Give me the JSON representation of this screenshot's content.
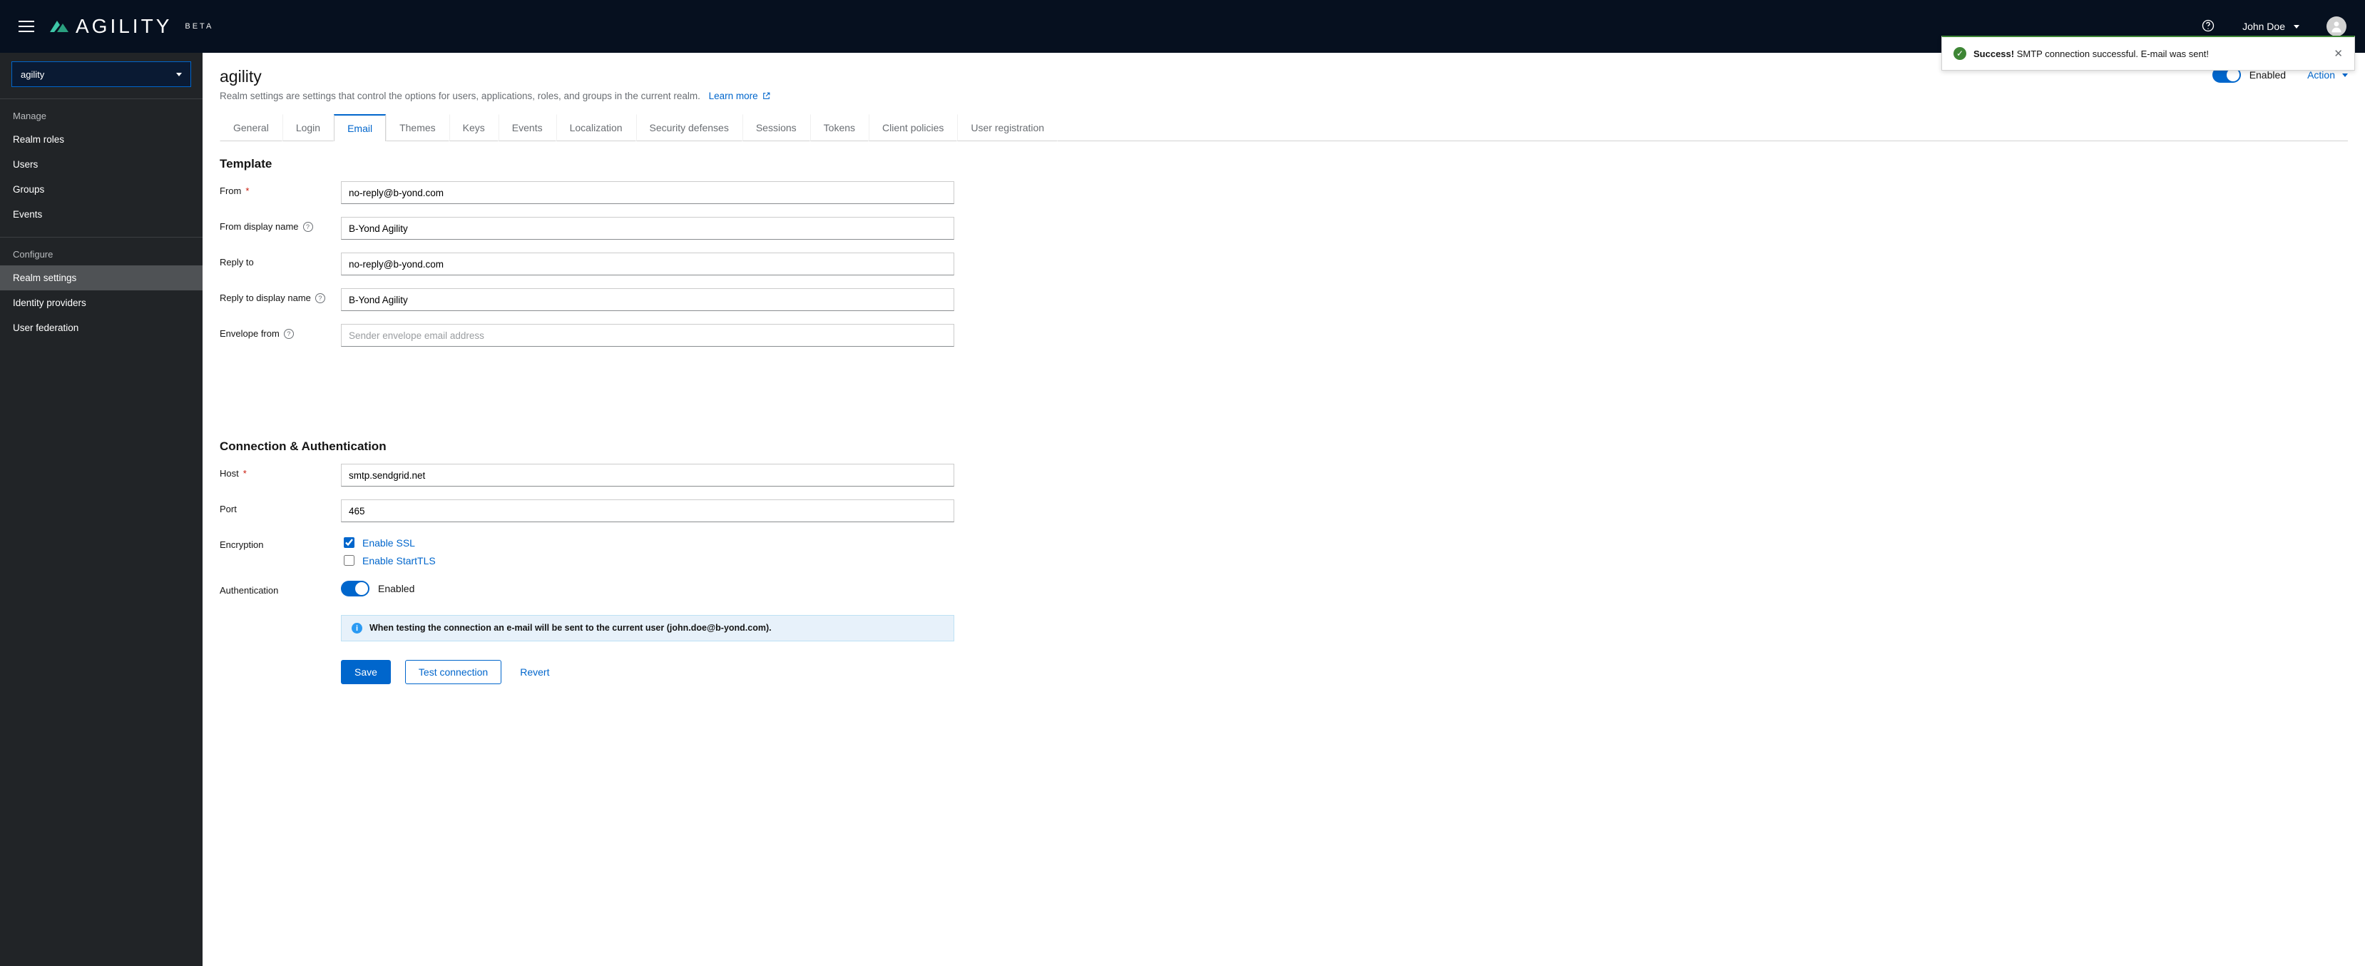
{
  "brand": {
    "name": "AGILITY",
    "beta": "BETA"
  },
  "header": {
    "username": "John Doe"
  },
  "toast": {
    "title": "Success!",
    "message": "SMTP connection successful. E-mail was sent!"
  },
  "sidebar": {
    "realm_selected": "agility",
    "manage_label": "Manage",
    "configure_label": "Configure",
    "items_manage": [
      "Realm roles",
      "Users",
      "Groups",
      "Events"
    ],
    "items_configure": [
      "Realm settings",
      "Identity providers",
      "User federation"
    ]
  },
  "page": {
    "title": "agility",
    "description": "Realm settings are settings that control the options for users, applications, roles, and groups in the current realm.",
    "learn_more": "Learn more",
    "enabled_label": "Enabled",
    "action_label": "Action"
  },
  "tabs": [
    "General",
    "Login",
    "Email",
    "Themes",
    "Keys",
    "Events",
    "Localization",
    "Security defenses",
    "Sessions",
    "Tokens",
    "Client policies",
    "User registration"
  ],
  "template_section": {
    "title": "Template",
    "labels": {
      "from": "From",
      "from_display": "From display name",
      "reply_to": "Reply to",
      "reply_to_display": "Reply to display name",
      "envelope_from": "Envelope from"
    },
    "values": {
      "from": "no-reply@b-yond.com",
      "from_display": "B-Yond Agility",
      "reply_to": "no-reply@b-yond.com",
      "reply_to_display": "B-Yond Agility",
      "envelope_from": ""
    },
    "placeholders": {
      "envelope_from": "Sender envelope email address"
    }
  },
  "connection_section": {
    "title": "Connection & Authentication",
    "labels": {
      "host": "Host",
      "port": "Port",
      "encryption": "Encryption",
      "authentication": "Authentication",
      "enable_ssl": "Enable SSL",
      "enable_starttls": "Enable StartTLS",
      "auth_enabled": "Enabled"
    },
    "values": {
      "host": "smtp.sendgrid.net",
      "port": "465"
    },
    "info": "When testing the connection an e-mail will be sent to the current user (john.doe@b-yond.com)."
  },
  "buttons": {
    "save": "Save",
    "test": "Test connection",
    "revert": "Revert"
  }
}
